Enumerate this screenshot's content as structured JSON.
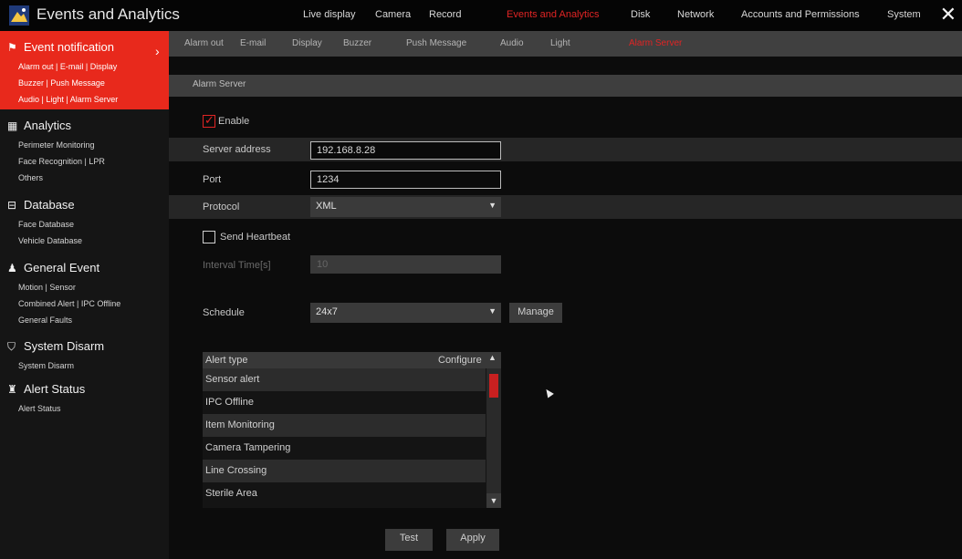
{
  "app": {
    "title": "Events and Analytics"
  },
  "topnav": [
    {
      "label": "Live display",
      "active": false
    },
    {
      "label": "Camera",
      "active": false
    },
    {
      "label": "Record",
      "active": false
    },
    {
      "label": "Events and Analytics",
      "active": true
    },
    {
      "label": "Disk",
      "active": false
    },
    {
      "label": "Network",
      "active": false
    },
    {
      "label": "Accounts and Permissions",
      "active": false
    },
    {
      "label": "System",
      "active": false
    }
  ],
  "subtabs": [
    {
      "label": "Alarm out",
      "active": false
    },
    {
      "label": "E-mail",
      "active": false
    },
    {
      "label": "Display",
      "active": false
    },
    {
      "label": "Buzzer",
      "active": false
    },
    {
      "label": "Push Message",
      "active": false
    },
    {
      "label": "Audio",
      "active": false
    },
    {
      "label": "Light",
      "active": false
    },
    {
      "label": "Alarm Server",
      "active": true
    }
  ],
  "sidebar": {
    "groups": [
      {
        "title": "Event notification",
        "icon": "alarm-flag-icon",
        "lines": [
          "Alarm out | E-mail | Display",
          "Buzzer | Push Message",
          "Audio | Light | Alarm Server"
        ],
        "active": true
      },
      {
        "title": "Analytics",
        "icon": "analytics-icon",
        "lines": [
          "Perimeter Monitoring",
          "Face Recognition | LPR",
          "Others"
        ]
      },
      {
        "title": "Database",
        "icon": "database-icon",
        "lines": [
          "Face Database",
          "Vehicle Database"
        ]
      },
      {
        "title": "General Event",
        "icon": "general-event-icon",
        "lines": [
          "Motion | Sensor",
          "Combined Alert | IPC Offline",
          "General Faults"
        ]
      },
      {
        "title": "System Disarm",
        "icon": "shield-icon",
        "lines": [
          "System Disarm"
        ]
      },
      {
        "title": "Alert Status",
        "icon": "alert-status-icon",
        "lines": [
          "Alert Status"
        ]
      }
    ]
  },
  "form": {
    "section_title": "Alarm Server",
    "enable_label": "Enable",
    "enable_checked": true,
    "server_address_label": "Server address",
    "server_address_value": "192.168.8.28",
    "port_label": "Port",
    "port_value": "1234",
    "protocol_label": "Protocol",
    "protocol_value": "XML",
    "send_heartbeat_label": "Send Heartbeat",
    "send_heartbeat_checked": false,
    "interval_label": "Interval Time[s]",
    "interval_value": "10",
    "schedule_label": "Schedule",
    "schedule_value": "24x7",
    "manage_label": "Manage"
  },
  "alert_table": {
    "headers": [
      "Alert type",
      "Configure"
    ],
    "rows": [
      "Sensor alert",
      "IPC Offline",
      "Item Monitoring",
      "Camera Tampering",
      "Line Crossing",
      "Sterile Area"
    ]
  },
  "buttons": {
    "test": "Test",
    "apply": "Apply"
  },
  "colors": {
    "accent": "#e02424",
    "sidebar_active": "#e8291c"
  }
}
